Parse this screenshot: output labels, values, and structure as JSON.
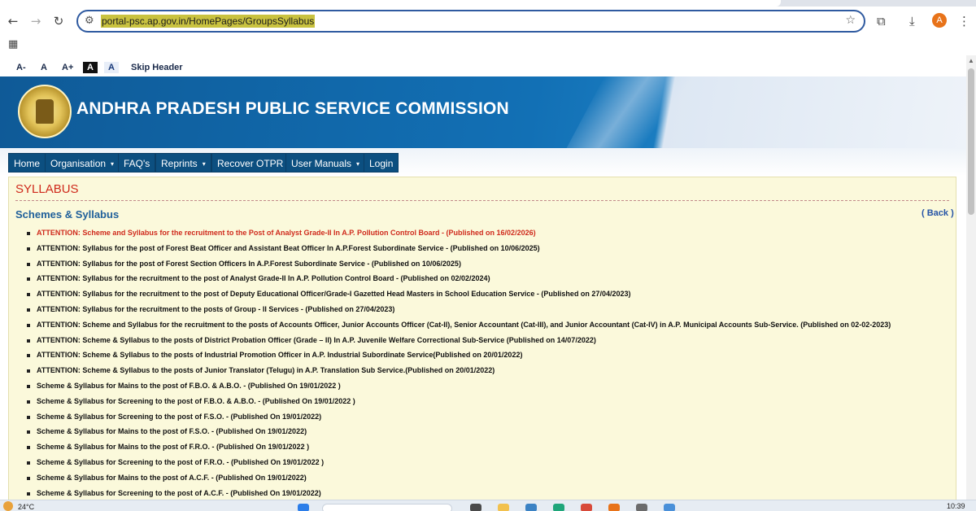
{
  "browser": {
    "url": "portal-psc.ap.gov.in/HomePages/GroupsSyllabus",
    "avatar_letter": "A",
    "icons": {
      "back": "arrow-left-icon",
      "forward": "arrow-right-icon",
      "reload": "reload-icon",
      "site_info": "tune-icon",
      "bookmark": "star-icon",
      "extensions": "puzzle-icon",
      "download": "download-icon",
      "menu": "kebab-menu-icon",
      "apps": "apps-grid-icon"
    }
  },
  "accessibility": {
    "font_decrease": "A-",
    "font_normal": "A",
    "font_increase": "A+",
    "contrast_dark": "A",
    "contrast_light": "A",
    "skip": "Skip Header"
  },
  "banner": {
    "title": "ANDHRA PRADESH PUBLIC SERVICE COMMISSION",
    "logo_icon": "ap-state-emblem"
  },
  "nav": {
    "items": [
      {
        "label": "Home",
        "dropdown": false
      },
      {
        "label": "Organisation",
        "dropdown": true
      },
      {
        "label": "FAQ's",
        "dropdown": false
      },
      {
        "label": "Reprints",
        "dropdown": true
      },
      {
        "label": "Recover OTPR",
        "dropdown": false
      },
      {
        "label": "User Manuals",
        "dropdown": true
      },
      {
        "label": "Login",
        "dropdown": false
      }
    ],
    "caret": "▾"
  },
  "content": {
    "heading": "SYLLABUS",
    "subheading": "Schemes & Syllabus",
    "back_link": "( Back )",
    "items": [
      {
        "text": "ATTENTION: Scheme and Syllabus for the recruitment to the Post of Analyst Grade-II In A.P. Pollution Control Board - (Published on 16/02/2026)",
        "highlight": true
      },
      {
        "text": "ATTENTION: Syllabus for the post of Forest Beat Officer and Assistant Beat Officer In A.P.Forest Subordinate Service - (Published on 10/06/2025)",
        "highlight": false
      },
      {
        "text": "ATTENTION: Syllabus for the post of Forest Section Officers In A.P.Forest Subordinate Service - (Published on 10/06/2025)",
        "highlight": false
      },
      {
        "text": "ATTENTION: Syllabus for the recruitment to the post of Analyst Grade-II In A.P. Pollution Control Board - (Published on 02/02/2024)",
        "highlight": false
      },
      {
        "text": "ATTENTION: Syllabus for the recruitment to the post of Deputy Educational Officer/Grade-I Gazetted Head Masters in School Education Service - (Published on 27/04/2023)",
        "highlight": false
      },
      {
        "text": "ATTENTION: Syllabus for the recruitment to the posts of Group - II Services - (Published on 27/04/2023)",
        "highlight": false
      },
      {
        "text": "ATTENTION: Scheme and Syllabus for the recruitment to the posts of Accounts Officer, Junior Accounts Officer (Cat-II), Senior Accountant (Cat-III), and Junior Accountant (Cat-IV) in A.P. Municipal Accounts Sub-Service. (Published on 02-02-2023)",
        "highlight": false
      },
      {
        "text": "ATTENTION: Scheme & Syllabus to the posts of District Probation Officer (Grade – II) In A.P. Juvenile Welfare Correctional Sub-Service (Published on 14/07/2022)",
        "highlight": false
      },
      {
        "text": "ATTENTION: Scheme & Syllabus to the posts of Industrial Promotion Officer in A.P. Industrial Subordinate Service(Published on 20/01/2022)",
        "highlight": false
      },
      {
        "text": "ATTENTION: Scheme & Syllabus to the posts of Junior Translator (Telugu) in A.P. Translation Sub Service.(Published on 20/01/2022)",
        "highlight": false
      },
      {
        "text": "Scheme & Syllabus for Mains to the post of F.B.O. & A.B.O. - (Published On 19/01/2022 )",
        "highlight": false
      },
      {
        "text": "Scheme & Syllabus for Screening to the post of F.B.O. & A.B.O. - (Published On 19/01/2022 )",
        "highlight": false
      },
      {
        "text": "Scheme & Syllabus for Screening to the post of F.S.O. - (Published On 19/01/2022)",
        "highlight": false
      },
      {
        "text": "Scheme & Syllabus for Mains to the post of F.S.O. - (Published On 19/01/2022)",
        "highlight": false
      },
      {
        "text": "Scheme & Syllabus for Mains to the post of F.R.O. - (Published On 19/01/2022 )",
        "highlight": false
      },
      {
        "text": "Scheme & Syllabus for Screening to the post of F.R.O. - (Published On 19/01/2022 )",
        "highlight": false
      },
      {
        "text": "Scheme & Syllabus for Mains to the post of A.C.F. - (Published On 19/01/2022)",
        "highlight": false
      },
      {
        "text": "Scheme & Syllabus for Screening to the post of A.C.F. - (Published On 19/01/2022)",
        "highlight": false
      }
    ]
  },
  "taskbar": {
    "temperature": "24°C",
    "time": "10:39"
  },
  "colors": {
    "banner_blue": "#0f5a97",
    "nav_blue": "#0c4f80",
    "content_bg": "#fbf9db",
    "heading_red": "#cf2a1c",
    "subheading_blue": "#1f5f9a"
  }
}
